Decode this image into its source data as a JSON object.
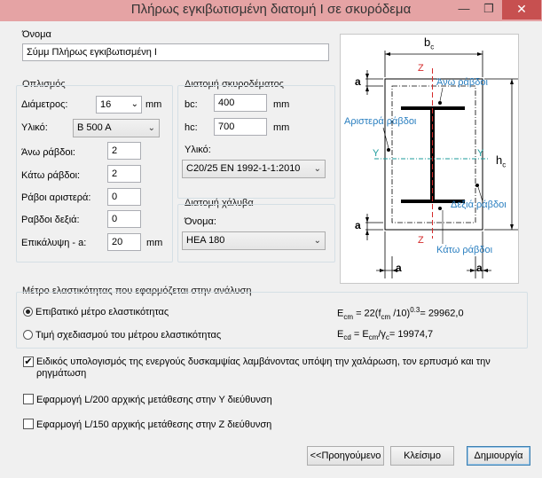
{
  "window": {
    "title": "Πλήρως εγκιβωτισμένη διατομή Ι σε σκυρόδεμα",
    "min_glyph": "—",
    "max_glyph": "❐",
    "close_glyph": "✕"
  },
  "name_section": {
    "label": "Όνομα",
    "value": "Σύμμ Πλήρως εγκιβωτισμένη Ι"
  },
  "reinforcement": {
    "title": "Οπλισμός",
    "diameter_label": "Διάμετρος:",
    "diameter_value": "16",
    "diameter_unit": "mm",
    "material_label": "Υλικό:",
    "material_value": "Β 500 Α",
    "top_bars_label": "Άνω ράβδοι:",
    "top_bars_value": "2",
    "bottom_bars_label": "Κάτω ράβδοι:",
    "bottom_bars_value": "2",
    "left_bars_label": "Ράβοι αριστερά:",
    "left_bars_value": "0",
    "right_bars_label": "Ραβδοι δεξιά:",
    "right_bars_value": "0",
    "cover_label": "Επικάλυψη - a:",
    "cover_value": "20",
    "cover_unit": "mm"
  },
  "concrete_section": {
    "title": "Διατομή σκυροδέματος",
    "bc_label": "bc:",
    "bc_value": "400",
    "bc_unit": "mm",
    "hc_label": "hc:",
    "hc_value": "700",
    "hc_unit": "mm",
    "material_label": "Υλικό:",
    "material_value": "C20/25  EN 1992-1-1:2010"
  },
  "steel_section": {
    "title": "Διατομή χάλυβα",
    "name_label": "Όνομα:",
    "name_value": "HEA 180"
  },
  "diagram": {
    "bc": "b",
    "bc_sub": "c",
    "hc": "h",
    "hc_sub": "c",
    "z_top": "Z",
    "z_bottom": "Z",
    "y_left": "Y",
    "y_right": "Y",
    "a_top": "a",
    "a_bottom": "a",
    "a_left": "a",
    "a_right": "a",
    "top_bars": "Άνω ράβδοι",
    "left_bars": "Αριστερά ράβδοι",
    "right_bars": "Δεξιά ράβδοι",
    "bottom_bars": "Κάτω ράβδοι",
    "colors": {
      "blue": "#2a7fc0",
      "red": "#d42a2a",
      "teal": "#1c9b9b"
    }
  },
  "elasticity": {
    "title": "Μέτρο ελαστικότητας που εφαρμόζεται στην ανάλυση",
    "option1_label": "Επιβατικό μέτρο ελαστικότητας",
    "option2_label": "Τιμή σχεδιασμού του μέτρου ελαστικότητας",
    "formula1_value": "29962,0",
    "formula2_value": "19974,7"
  },
  "options": {
    "creep_label": "Ειδικός υπολογισμός της ενεργούς δυσκαμψίας λαμβάνοντας υπόψη την χαλάρωση, τον ερπυσμό και την ρηγμάτωση",
    "creep_checked": "✔",
    "l200_label": "Εφαρμογή L/200 αρχικής μετάθεσης στην Y διεύθυνση",
    "l150_label": "Εφαρμογή L/150 αρχικής μετάθεσης στην Z διεύθυνση"
  },
  "buttons": {
    "previous": "<<Προηγούμενο",
    "close": "Κλείσιμο",
    "create": "Δημιουργία"
  }
}
